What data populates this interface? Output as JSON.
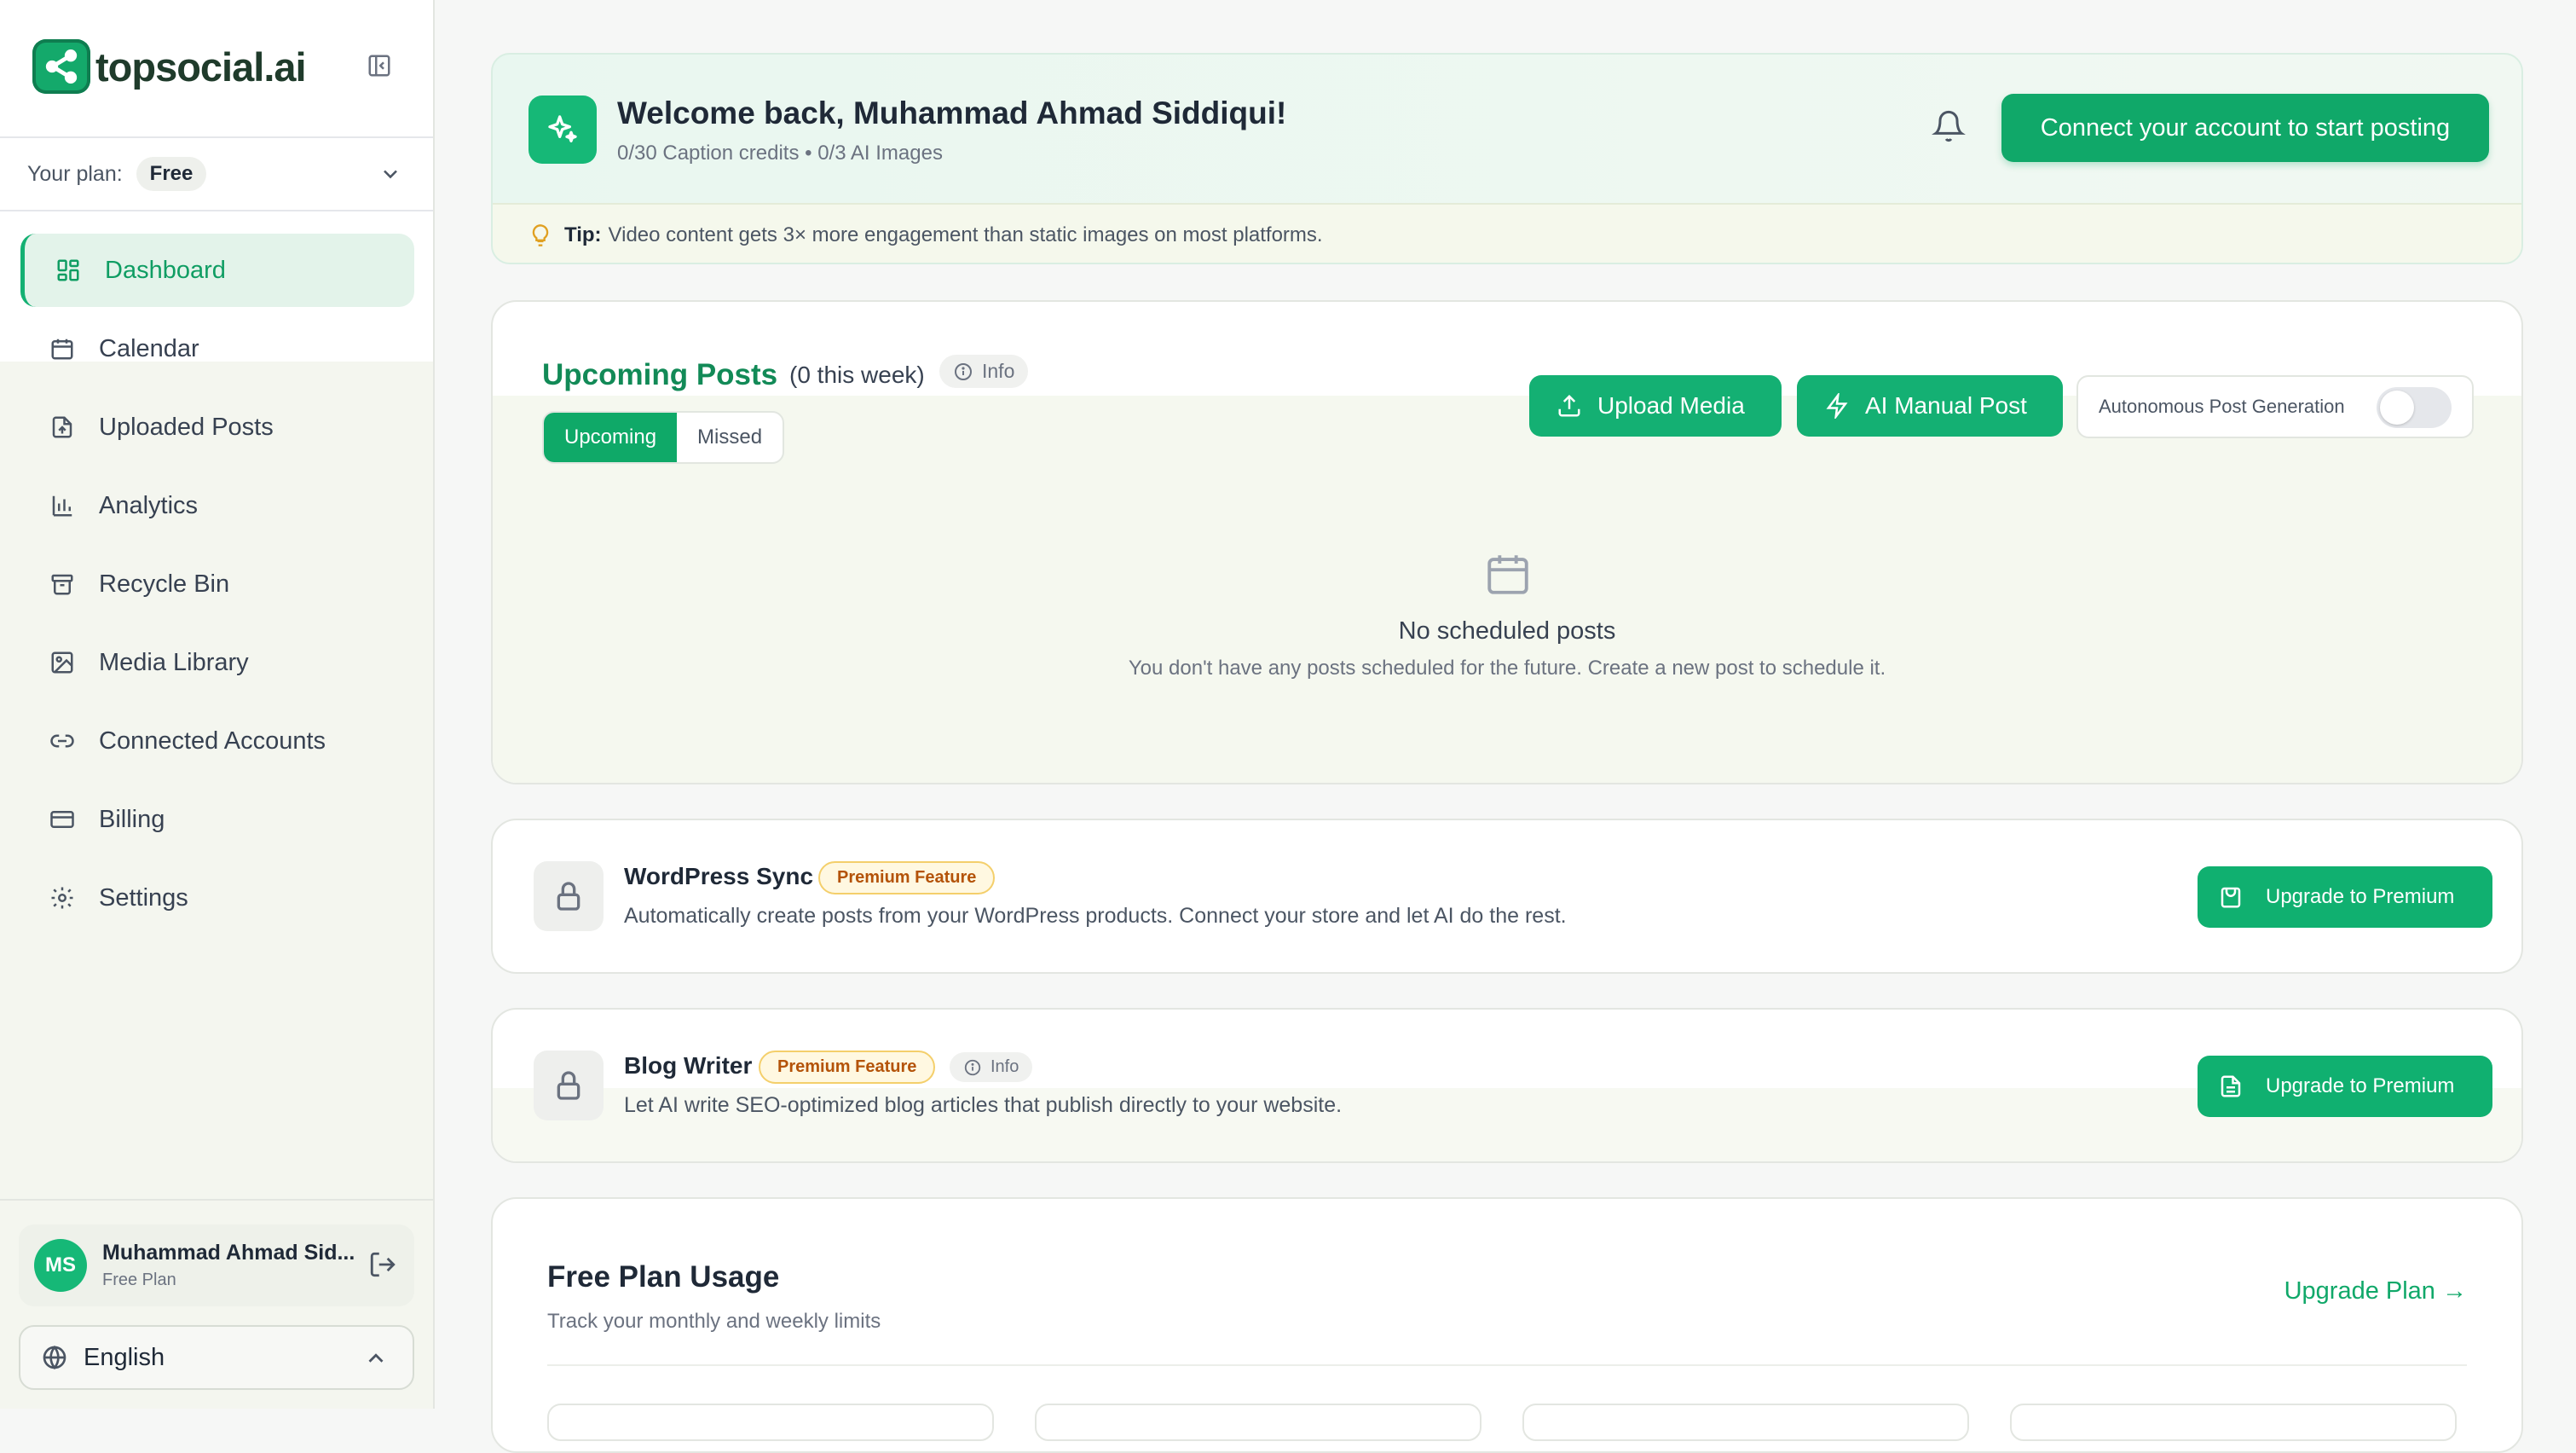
{
  "brand": {
    "name": "topsocial.ai"
  },
  "sidebar": {
    "plan_label": "Your plan:",
    "plan_value": "Free",
    "items": [
      {
        "label": "Dashboard",
        "icon": "dashboard-grid-icon",
        "active": true
      },
      {
        "label": "Calendar",
        "icon": "calendar-icon"
      },
      {
        "label": "Uploaded Posts",
        "icon": "file-upload-icon"
      },
      {
        "label": "Analytics",
        "icon": "bar-chart-icon"
      },
      {
        "label": "Recycle Bin",
        "icon": "archive-icon"
      },
      {
        "label": "Media Library",
        "icon": "image-icon"
      },
      {
        "label": "Connected Accounts",
        "icon": "link-icon"
      },
      {
        "label": "Billing",
        "icon": "credit-card-icon"
      },
      {
        "label": "Settings",
        "icon": "gear-icon"
      }
    ],
    "user": {
      "initials": "MS",
      "name": "Muhammad Ahmad Sid...",
      "plan": "Free Plan"
    },
    "language": "English"
  },
  "welcome": {
    "title": "Welcome back, Muhammad Ahmad Siddiqui!",
    "credits": "0/30 Caption credits • 0/3 AI Images",
    "connect_label": "Connect your account to start posting",
    "tip_label": "Tip:",
    "tip_text": "Video content gets 3× more engagement than static images on most platforms."
  },
  "upcoming": {
    "title": "Upcoming Posts",
    "count": "(0 this week)",
    "info": "Info",
    "tabs": [
      "Upcoming",
      "Missed"
    ],
    "upload_label": "Upload Media",
    "manual_label": "AI Manual Post",
    "autonomous_label": "Autonomous Post Generation",
    "autonomous_on": false,
    "empty_title": "No scheduled posts",
    "empty_text": "You don't have any posts scheduled for the future. Create a new post to schedule it."
  },
  "features": [
    {
      "title": "WordPress Sync",
      "badge": "Premium Feature",
      "description": "Automatically create posts from your WordPress products. Connect your store and let AI do the rest.",
      "button": "Upgrade to Premium"
    },
    {
      "title": "Blog Writer",
      "badge": "Premium Feature",
      "info": "Info",
      "description": "Let AI write SEO-optimized blog articles that publish directly to your website.",
      "button": "Upgrade to Premium"
    }
  ],
  "usage": {
    "title": "Free Plan Usage",
    "subtitle": "Track your monthly and weekly limits",
    "link": "Upgrade Plan →"
  },
  "colors": {
    "accent": "#10a869",
    "accent_light": "#e3f3ea",
    "premium": "#b45309"
  }
}
